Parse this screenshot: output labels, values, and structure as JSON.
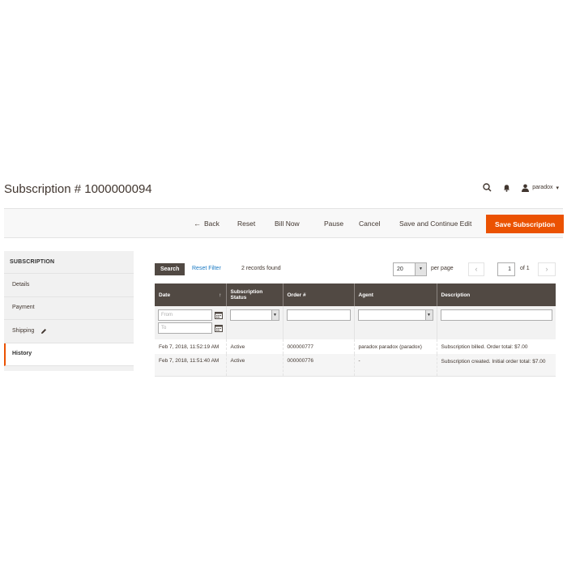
{
  "page": {
    "title": "Subscription # 1000000094"
  },
  "header": {
    "user_name": "paradox",
    "user_caret": "▾"
  },
  "toolbar": {
    "back_label": "Back",
    "reset_label": "Reset",
    "bill_now_label": "Bill Now",
    "pause_label": "Pause",
    "cancel_label": "Cancel",
    "save_continue_label": "Save and Continue Edit",
    "save_label": "Save Subscription"
  },
  "sidebar": {
    "heading": "SUBSCRIPTION",
    "items": [
      {
        "label": "Details"
      },
      {
        "label": "Payment"
      },
      {
        "label": "Shipping"
      },
      {
        "label": "History"
      }
    ],
    "active": "History"
  },
  "grid": {
    "search_label": "Search",
    "reset_filter_label": "Reset Filter",
    "records_found": "2 records found",
    "per_page_value": "20",
    "per_page_label": "per page",
    "prev_glyph": "‹",
    "current_page": "1",
    "of_label": "of 1",
    "next_glyph": "›",
    "columns": [
      "Date",
      "Subscription Status",
      "Order #",
      "Agent",
      "Description"
    ],
    "sort_glyph": "↑",
    "filter_from_placeholder": "From",
    "filter_to_placeholder": "To",
    "rows": [
      {
        "date": "Feb 7, 2018, 11:52:19 AM",
        "status": "Active",
        "order": "000000777",
        "agent": "paradox paradox (paradox)",
        "description": "Subscription billed. Order total: $7.00"
      },
      {
        "date": "Feb 7, 2018, 11:51:40 AM",
        "status": "Active",
        "order": "000000776",
        "agent": "-",
        "description": "Subscription created. Initial order total: $7.00"
      }
    ]
  },
  "colors": {
    "accent": "#eb5202",
    "grid_header": "#514943",
    "link": "#1979c3"
  },
  "icons": [
    "search-icon",
    "bell-icon",
    "user-icon",
    "back-arrow-icon",
    "pencil-icon",
    "calendar-icon",
    "chevron-down-icon"
  ]
}
